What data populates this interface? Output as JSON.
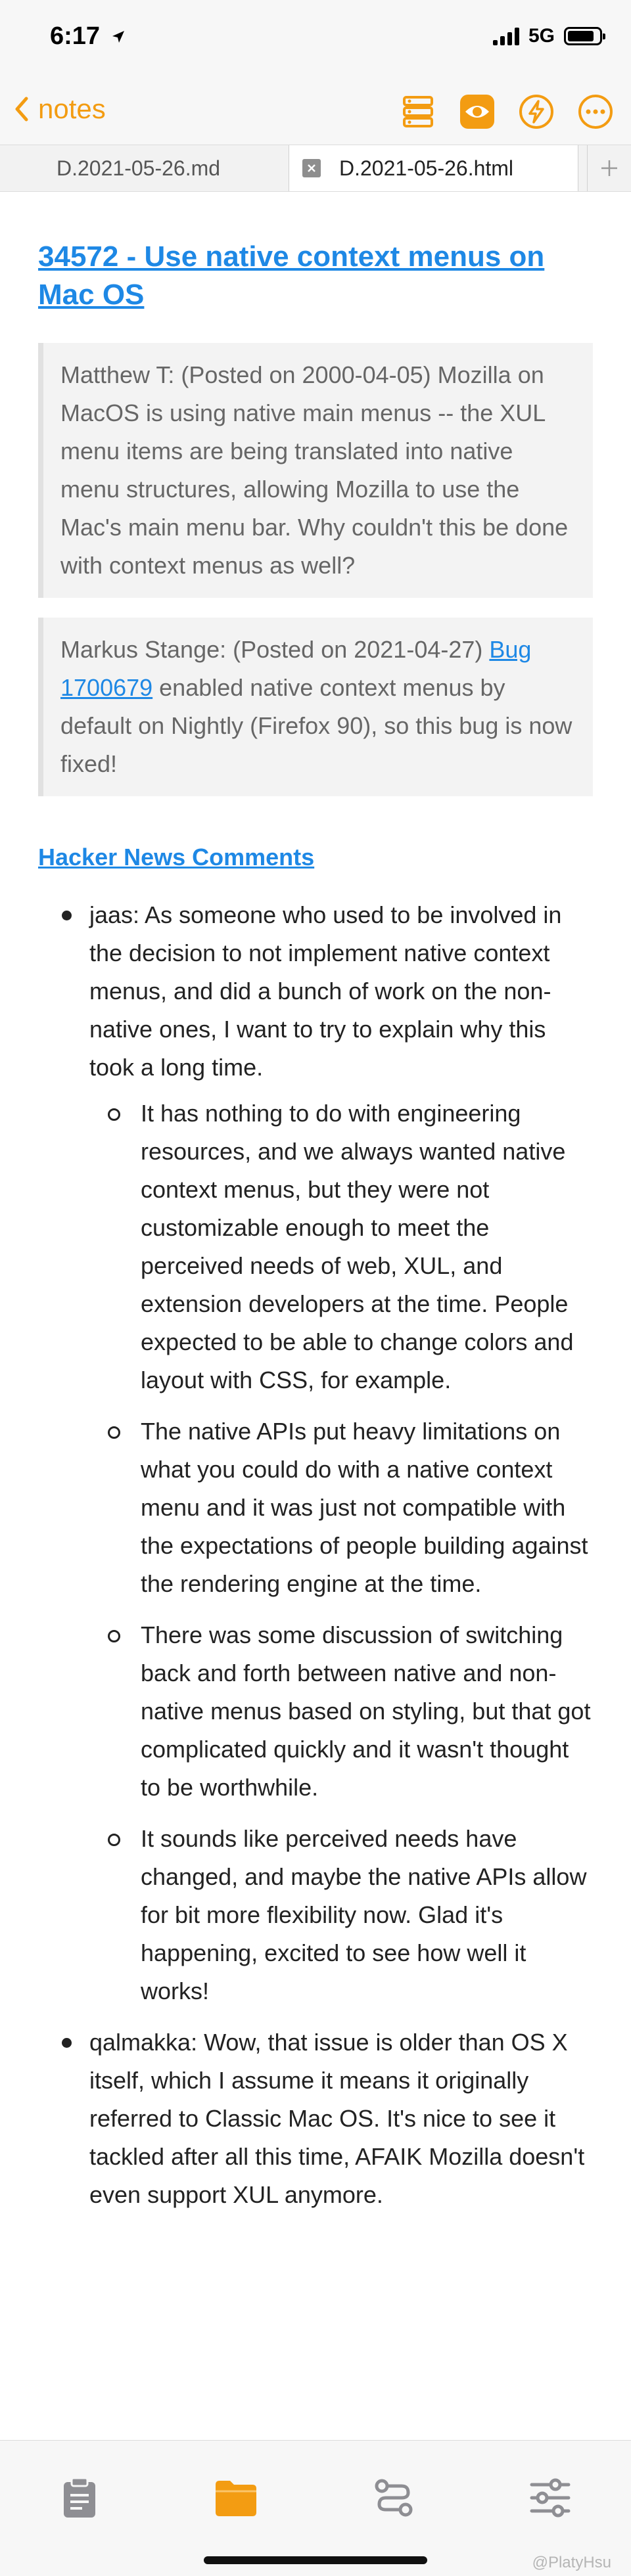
{
  "status_bar": {
    "time": "6:17",
    "network": "5G"
  },
  "nav": {
    "back_label": "notes",
    "accent_color": "#f39c12",
    "icons": [
      "layers-icon",
      "eye-icon",
      "lightning-icon",
      "more-icon"
    ]
  },
  "tabs": [
    {
      "label": "D.2021-05-26.md",
      "active": false
    },
    {
      "label": "D.2021-05-26.html",
      "active": true
    }
  ],
  "document": {
    "title": "34572 - Use native context menus on Mac OS",
    "quotes": [
      {
        "text": "Matthew T: (Posted on 2000-04-05) Mozilla on MacOS is using native main menus -- the XUL menu items are being translated into native menu structures, allowing Mozilla to use the Mac's main menu bar. Why couldn't this be done with context menus as well?"
      },
      {
        "prefix": "Markus Stange: (Posted on 2021-04-27) ",
        "link": "Bug 1700679",
        "suffix": " enabled native context menus by default on Nightly (Firefox 90), so this bug is now fixed!"
      }
    ],
    "hn_heading": "Hacker News Comments",
    "comments": [
      {
        "text": "jaas: As someone who used to be involved in the decision to not implement native context menus, and did a bunch of work on the non-native ones, I want to try to explain why this took a long time.",
        "replies": [
          "It has nothing to do with engineering resources, and we always wanted native context menus, but they were not customizable enough to meet the perceived needs of web, XUL, and extension developers at the time. People expected to be able to change colors and layout with CSS, for example.",
          "The native APIs put heavy limitations on what you could do with a native context menu and it was just not compatible with the expectations of people building against the rendering engine at the time.",
          "There was some discussion of switching back and forth between native and non-native menus based on styling, but that got complicated quickly and it wasn't thought to be worthwhile.",
          "It sounds like perceived needs have changed, and maybe the native APIs allow for bit more flexibility now. Glad it's happening, excited to see how well it works!"
        ]
      },
      {
        "text": "qalmakka: Wow, that issue is older than OS X itself, which I assume it means it originally referred to Classic Mac OS. It's nice to see it tackled after all this time, AFAIK Mozilla doesn't even support XUL anymore.",
        "replies": []
      }
    ]
  },
  "toolbar": {
    "items": [
      "clipboard-icon",
      "folder-icon",
      "route-icon",
      "sliders-icon"
    ],
    "active_item": "folder-icon"
  },
  "watermark": "@PlatyHsu"
}
